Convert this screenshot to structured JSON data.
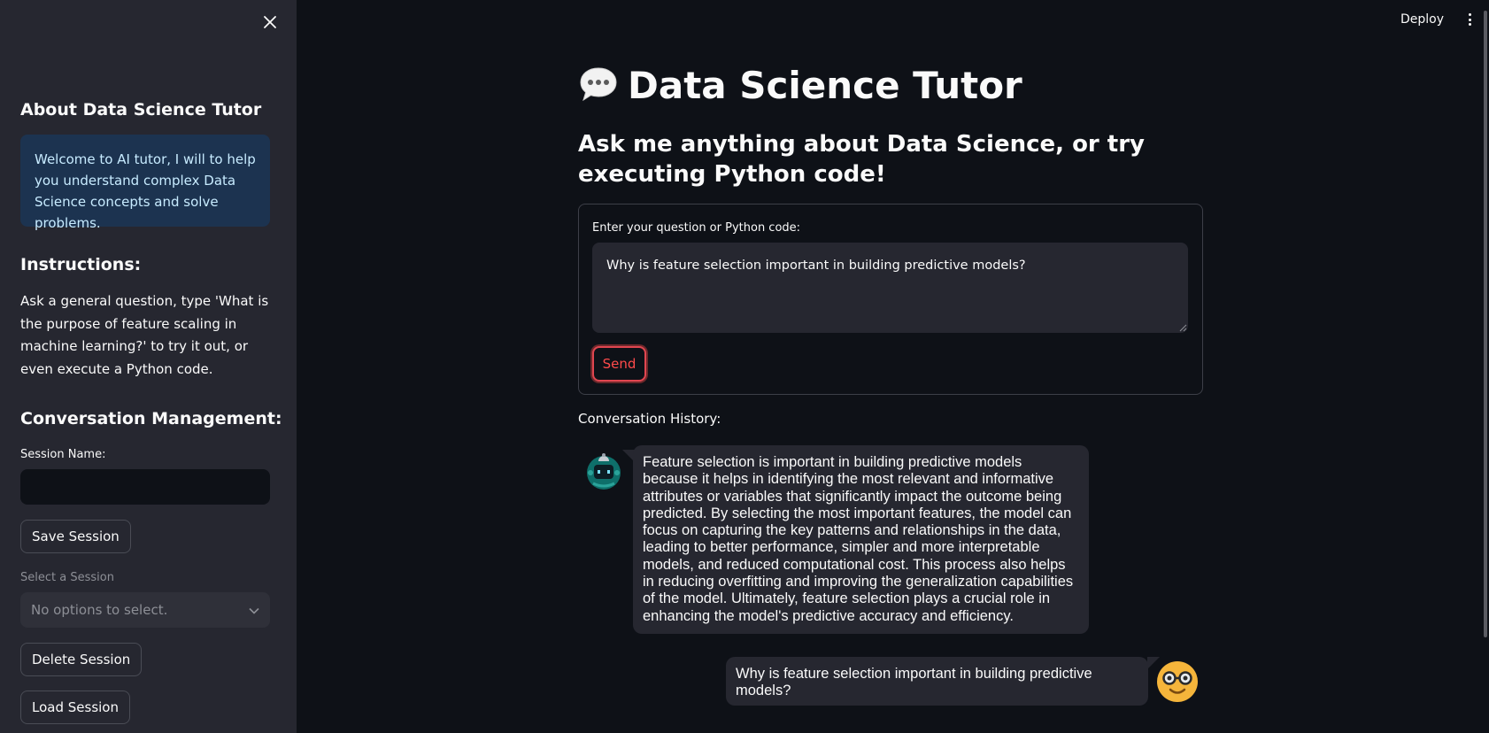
{
  "sidebar": {
    "close_icon": "close-icon",
    "about_title": "About Data Science Tutor",
    "info_text": "Welcome to AI tutor, I will to help you understand complex Data Science concepts and solve problems.",
    "instructions_title": "Instructions:",
    "instructions_text": "Ask a general question, type 'What is the purpose of feature scaling in machine learning?' to try it out, or even execute a Python code.",
    "conversation_title": "Conversation Management:",
    "session_name_label": "Session Name:",
    "session_name_value": "",
    "save_button": "Save Session",
    "select_label": "Select a Session",
    "select_placeholder": "No options to select.",
    "delete_button": "Delete Session",
    "load_button": "Load Session"
  },
  "header": {
    "deploy_label": "Deploy",
    "menu_icon": "kebab-menu-icon"
  },
  "main": {
    "title_icon": "speech-bubble-icon",
    "title": "Data Science Tutor",
    "subtitle": "Ask me anything about Data Science, or try executing Python code!",
    "form": {
      "label": "Enter your question or Python code:",
      "value": "Why is feature selection important in building predictive models?",
      "send_label": "Send"
    },
    "history_label": "Conversation History:",
    "messages": [
      {
        "role": "bot",
        "avatar": "robot-avatar-icon",
        "text": "Feature selection is important in building predictive models because it helps in identifying the most relevant and informative attributes or variables that significantly impact the outcome being predicted. By selecting the most important features, the model can focus on capturing the key patterns and relationships in the data, leading to better performance, simpler and more interpretable models, and reduced computational cost. This process also helps in reducing overfitting and improving the generalization capabilities of the model. Ultimately, feature selection plays a crucial role in enhancing the model's predictive accuracy and efficiency."
      },
      {
        "role": "user",
        "avatar": "nerd-face-avatar-icon",
        "text": "Why is feature selection important in building predictive models?"
      }
    ]
  },
  "colors": {
    "background": "#0e1117",
    "sidebar": "#262730",
    "info_bg": "#1c3350",
    "info_text": "#c7ebff",
    "accent": "#ff4b4b",
    "bubble": "#262730"
  }
}
